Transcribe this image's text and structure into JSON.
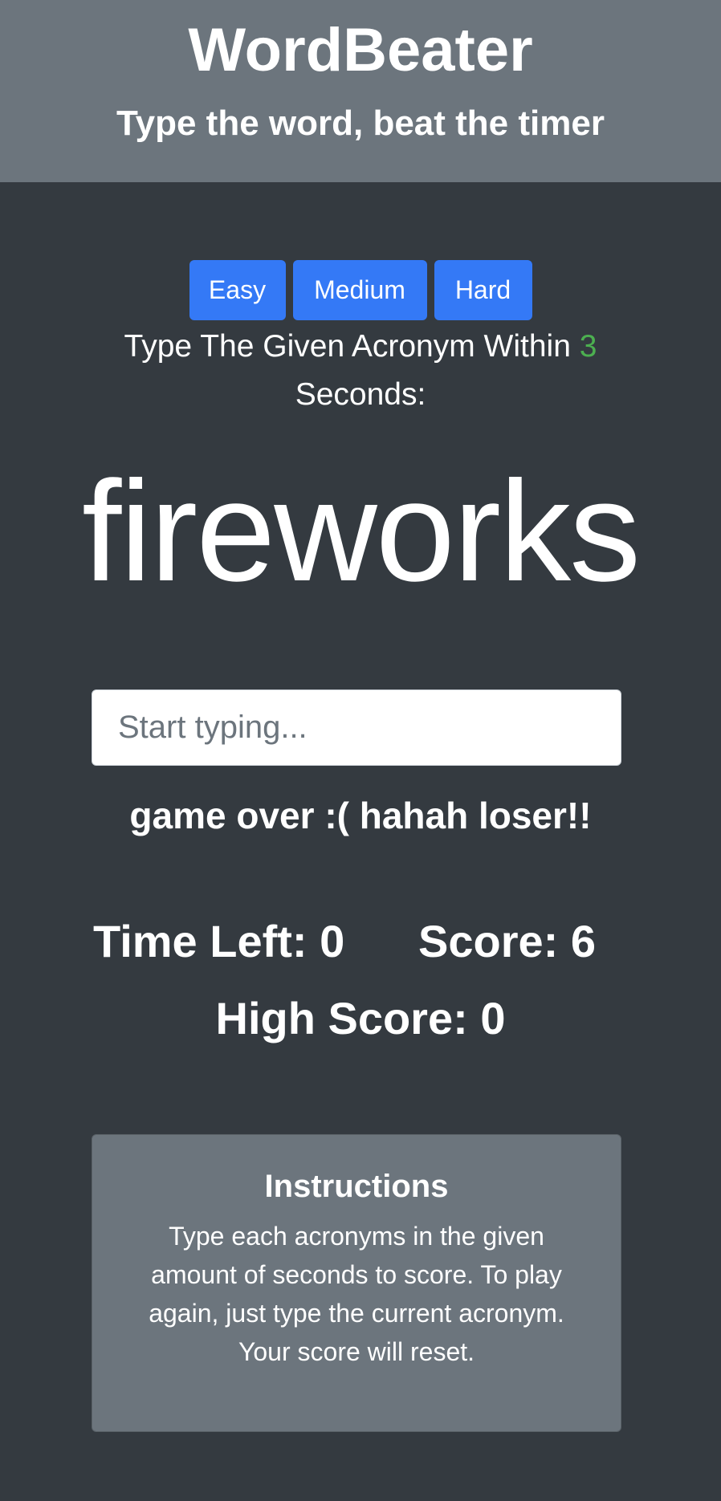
{
  "header": {
    "title": "WordBeater",
    "subtitle": "Type the word, beat the timer"
  },
  "difficulty": {
    "buttons": [
      {
        "label": "Easy"
      },
      {
        "label": "Medium"
      },
      {
        "label": "Hard"
      }
    ]
  },
  "prompt": {
    "prefix": "Type The Given Acronym Within ",
    "seconds": "3",
    "suffix": " Seconds:",
    "seconds_color": "#4caf50"
  },
  "game": {
    "current_word": "fireworks",
    "input_placeholder": "Start typing...",
    "input_value": "",
    "message": "game over :( hahah loser!!"
  },
  "stats": {
    "time_left_label": "Time Left: ",
    "time_left": "0",
    "score_label": "Score: ",
    "score": "6",
    "high_score_label": "High Score: ",
    "high_score": "0"
  },
  "instructions": {
    "title": "Instructions",
    "body": "Type each acronyms in the given amount of seconds to score. To play again, just type the current acronym. Your score will reset."
  },
  "colors": {
    "header_bg": "#6c757d",
    "page_bg": "#343a40",
    "button_primary": "#3479f6",
    "accent_green": "#4caf50"
  }
}
